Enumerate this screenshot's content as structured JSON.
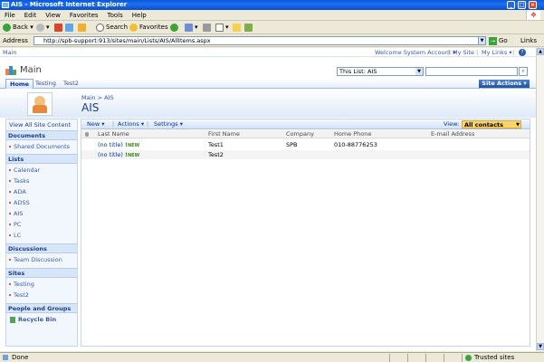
{
  "window": {
    "title": "AIS - Microsoft Internet Explorer"
  },
  "menu": [
    "File",
    "Edit",
    "View",
    "Favorites",
    "Tools",
    "Help"
  ],
  "toolbar": {
    "back": "Back",
    "search": "Search",
    "favorites": "Favorites"
  },
  "address": {
    "label": "Address",
    "url": "http://spb-support:913/sites/main/Lists/AIS/AllItems.aspx",
    "go": "Go",
    "links": "Links"
  },
  "sp": {
    "site_label": "Main",
    "welcome": "Welcome System Account",
    "my_site": "My Site",
    "my_links": "My Links",
    "site_title": "Main",
    "search_scope": "This List: AIS",
    "tabs": [
      "Home",
      "Testing",
      "Test2"
    ],
    "site_actions": "Site Actions",
    "breadcrumb": "Main > AIS",
    "page_title": "AIS"
  },
  "leftnav": {
    "view_all": "View All Site Content",
    "sections": [
      {
        "header": "Documents",
        "items": [
          "Shared Documents"
        ]
      },
      {
        "header": "Lists",
        "items": [
          "Calendar",
          "Tasks",
          "ADA",
          "ADSS",
          "AIS",
          "PC",
          "LC"
        ]
      },
      {
        "header": "Discussions",
        "items": [
          "Team Discussion"
        ]
      },
      {
        "header": "Sites",
        "items": [
          "Testing",
          "Test2"
        ]
      },
      {
        "header": "People and Groups",
        "items": []
      }
    ],
    "recycle_bin": "Recycle Bin"
  },
  "list": {
    "toolbar": {
      "new": "New",
      "actions": "Actions",
      "settings": "Settings"
    },
    "view_label": "View:",
    "view_value": "All contacts",
    "columns": [
      "Last Name",
      "First Name",
      "Company",
      "Home Phone",
      "E-mail Address"
    ],
    "rows": [
      {
        "last": "(no title)",
        "badge": "NEW",
        "first": "Test1",
        "company": "SPB",
        "phone": "010-88776253",
        "email": ""
      },
      {
        "last": "(no title)",
        "badge": "NEW",
        "first": "Test2",
        "company": "",
        "phone": "",
        "email": ""
      }
    ]
  },
  "status": {
    "left": "Done",
    "zone": "Trusted sites"
  },
  "colors": {
    "title_bar": "#0a58d8",
    "site_actions": "#21549d",
    "view_select": "#fbd36b",
    "nav_bullet": "#e05a1e"
  }
}
